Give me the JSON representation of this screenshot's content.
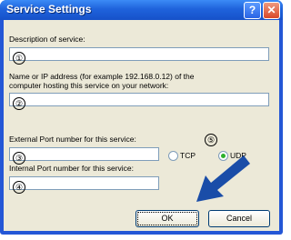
{
  "window": {
    "title": "Service Settings",
    "help_button": "?",
    "close_button": "✕"
  },
  "form": {
    "description": {
      "label": "Description of service:",
      "marker": "①",
      "value": ""
    },
    "host": {
      "label_line1": "Name or IP address (for example 192.168.0.12) of the",
      "label_line2": "computer hosting this service on your network:",
      "marker": "②",
      "value": ""
    },
    "external_port": {
      "label": "External Port number for this service:",
      "marker": "③",
      "value": ""
    },
    "internal_port": {
      "label": "Internal Port number for this service:",
      "marker": "④",
      "value": ""
    },
    "protocol": {
      "marker": "⑤",
      "tcp": "TCP",
      "udp": "UDP",
      "selected": "UDP"
    }
  },
  "buttons": {
    "ok": "OK",
    "cancel": "Cancel"
  },
  "colors": {
    "titlebar": "#1f63dc",
    "arrow": "#1a4da8",
    "client_bg": "#ece9d8"
  }
}
